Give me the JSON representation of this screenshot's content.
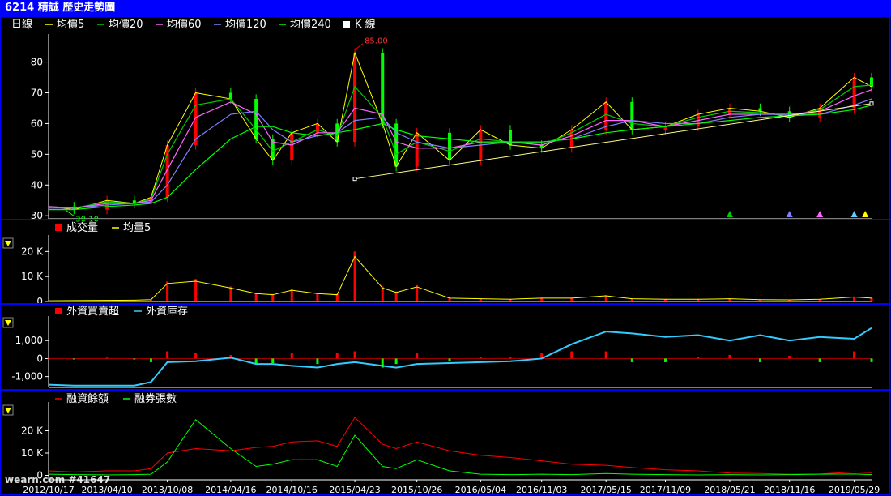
{
  "title": "6214 精誠  歷史走勢圖",
  "watermark": "wearn.com  #41647",
  "colors": {
    "frame": "#0000ff",
    "axis": "#ffffff",
    "candle_up": "#ff0000",
    "candle_down": "#00ff00",
    "ma5": "#ffff00",
    "ma20": "#00cc00",
    "ma60": "#ff66ff",
    "ma120": "#8080ff",
    "ma240": "#00ff00",
    "trendline": "#ffff88",
    "volume": "#ff0000",
    "volume_ma5": "#ffff00",
    "foreign_net": "#ff0000",
    "foreign_net_neg": "#00ff00",
    "foreign_inventory": "#33ccff",
    "margin": "#ff0000",
    "short": "#00ff00"
  },
  "chart_data": [
    {
      "type": "line",
      "panel": "price",
      "legend": [
        "日線",
        "均價5",
        "均價20",
        "均價60",
        "均價120",
        "均價240",
        "K 線"
      ],
      "y_ticks": [
        "30",
        "40",
        "50",
        "60",
        "70",
        "80"
      ],
      "ylim": [
        29,
        87
      ],
      "annotations": {
        "high": "85.00",
        "low": "30.10"
      },
      "x": [
        "2012/10/17",
        "2013/01/01",
        "2013/04/10",
        "2013/07/01",
        "2013/08/20",
        "2013/10/08",
        "2014/01/01",
        "2014/04/16",
        "2014/07/01",
        "2014/08/20",
        "2014/10/16",
        "2015/01/01",
        "2015/03/01",
        "2015/04/23",
        "2015/07/15",
        "2015/08/25",
        "2015/10/26",
        "2016/02/01",
        "2016/05/04",
        "2016/08/01",
        "2016/11/03",
        "2017/02/01",
        "2017/05/15",
        "2017/08/01",
        "2017/11/09",
        "2018/02/15",
        "2018/05/21",
        "2018/08/20",
        "2018/11/16",
        "2019/02/15",
        "2019/05/29",
        "2019/07/20"
      ],
      "series": [
        {
          "name": "K 線",
          "values": [
            33,
            32,
            35,
            34,
            36,
            53,
            70,
            68,
            55,
            48,
            57,
            60,
            54,
            83,
            60,
            46,
            57,
            48,
            58,
            53,
            52,
            58,
            67,
            58,
            59,
            63,
            65,
            64,
            62,
            65,
            75,
            72
          ]
        },
        {
          "name": "均價20",
          "values": [
            33,
            32.5,
            34.5,
            34,
            35.5,
            50,
            66,
            68,
            58,
            51,
            54,
            58,
            56,
            72,
            62,
            50,
            54,
            51,
            55,
            54,
            53,
            57,
            63,
            60,
            59,
            62,
            64,
            63.5,
            62.5,
            64.5,
            72,
            72.5
          ]
        },
        {
          "name": "均價60",
          "values": [
            33,
            32.5,
            34,
            34,
            35,
            45,
            62,
            67,
            63,
            54,
            53,
            57,
            57,
            65,
            63,
            54,
            52,
            52,
            54,
            54,
            53,
            56,
            61,
            61,
            59,
            61,
            63,
            63,
            63,
            64,
            69,
            71
          ]
        },
        {
          "name": "均價120",
          "values": [
            32.5,
            32.5,
            33.5,
            34,
            34.5,
            40,
            55,
            63,
            64,
            58,
            54,
            56,
            57,
            61,
            62,
            57,
            54,
            52,
            53,
            54,
            54,
            55,
            59,
            61,
            60,
            60,
            62,
            63,
            63,
            63,
            66,
            68
          ]
        },
        {
          "name": "均價240",
          "values": [
            32,
            32,
            33,
            33.5,
            34,
            36,
            45,
            55,
            59,
            59,
            57,
            56,
            57,
            58,
            60,
            58,
            56,
            55,
            54,
            54,
            54,
            55,
            57,
            58,
            59,
            60,
            61,
            62,
            62.5,
            63,
            64.5,
            66
          ]
        }
      ],
      "trendline": {
        "from": [
          "2015/04/23",
          42
        ],
        "to": [
          "2019/07/20",
          66.5
        ]
      },
      "markers": [
        {
          "x": "2018/05/21",
          "color": "#00cc00"
        },
        {
          "x": "2018/11/16",
          "color": "#8080ff"
        },
        {
          "x": "2019/02/15",
          "color": "#ff66ff"
        },
        {
          "x": "2019/05/29",
          "color": "#66ccff"
        },
        {
          "x": "2019/07/01",
          "color": "#ffff00"
        }
      ]
    },
    {
      "type": "bar",
      "panel": "volume",
      "legend": [
        "成交量",
        "均量5"
      ],
      "y_ticks": [
        "0",
        "10 K",
        "20 K"
      ],
      "ylim": [
        0,
        24000
      ],
      "x": [
        "2012/10/17",
        "2013/01/01",
        "2013/04/10",
        "2013/07/01",
        "2013/08/20",
        "2013/10/08",
        "2014/01/01",
        "2014/04/16",
        "2014/07/01",
        "2014/08/20",
        "2014/10/16",
        "2015/01/01",
        "2015/03/01",
        "2015/04/23",
        "2015/07/15",
        "2015/08/25",
        "2015/10/26",
        "2016/02/01",
        "2016/05/04",
        "2016/08/01",
        "2016/11/03",
        "2017/02/01",
        "2017/05/15",
        "2017/08/01",
        "2017/11/09",
        "2018/02/15",
        "2018/05/21",
        "2018/08/20",
        "2018/11/16",
        "2019/02/15",
        "2019/05/29",
        "2019/07/20"
      ],
      "values": [
        300,
        400,
        500,
        600,
        800,
        8000,
        9000,
        6000,
        3500,
        3000,
        5000,
        3500,
        3000,
        20000,
        6000,
        4000,
        6500,
        1500,
        1200,
        1000,
        1500,
        1500,
        2500,
        1200,
        1000,
        1000,
        1200,
        800,
        700,
        1000,
        2000,
        1500
      ]
    },
    {
      "type": "bar",
      "panel": "foreign",
      "legend": [
        "外資買賣超",
        "外資庫存"
      ],
      "y_ticks": [
        "-1,000",
        "0",
        "1,000"
      ],
      "ylim": [
        -1600,
        2000
      ],
      "x": [
        "2012/10/17",
        "2013/01/01",
        "2013/04/10",
        "2013/07/01",
        "2013/08/20",
        "2013/10/08",
        "2014/01/01",
        "2014/04/16",
        "2014/07/01",
        "2014/08/20",
        "2014/10/16",
        "2015/01/01",
        "2015/03/01",
        "2015/04/23",
        "2015/07/15",
        "2015/08/25",
        "2015/10/26",
        "2016/02/01",
        "2016/05/04",
        "2016/08/01",
        "2016/11/03",
        "2017/02/01",
        "2017/05/15",
        "2017/08/01",
        "2017/11/09",
        "2018/02/15",
        "2018/05/21",
        "2018/08/20",
        "2018/11/16",
        "2019/02/15",
        "2019/05/29",
        "2019/07/20"
      ],
      "values": [
        0,
        -50,
        50,
        -50,
        -200,
        400,
        300,
        200,
        -300,
        -250,
        300,
        -300,
        300,
        400,
        -500,
        -300,
        300,
        -150,
        100,
        100,
        300,
        400,
        400,
        -200,
        -200,
        100,
        200,
        -200,
        150,
        -200,
        400,
        -200
      ],
      "inventory": [
        -1450,
        -1500,
        -1500,
        -1500,
        -1300,
        -200,
        -150,
        50,
        -300,
        -300,
        -400,
        -500,
        -300,
        -200,
        -400,
        -500,
        -300,
        -250,
        -200,
        -150,
        0,
        800,
        1500,
        1400,
        1200,
        1300,
        1000,
        1300,
        1000,
        1200,
        1100,
        1700
      ]
    },
    {
      "type": "line",
      "panel": "margin",
      "legend": [
        "融資餘額",
        "融券張數"
      ],
      "y_ticks": [
        "0",
        "10 K",
        "20 K"
      ],
      "ylim": [
        -2000,
        30000
      ],
      "x": [
        "2012/10/17",
        "2013/01/01",
        "2013/04/10",
        "2013/07/01",
        "2013/08/20",
        "2013/10/08",
        "2014/01/01",
        "2014/04/16",
        "2014/07/01",
        "2014/08/20",
        "2014/10/16",
        "2015/01/01",
        "2015/03/01",
        "2015/04/23",
        "2015/07/15",
        "2015/08/25",
        "2015/10/26",
        "2016/02/01",
        "2016/05/04",
        "2016/08/01",
        "2016/11/03",
        "2017/02/01",
        "2017/05/15",
        "2017/08/01",
        "2017/11/09",
        "2018/02/15",
        "2018/05/21",
        "2018/08/20",
        "2018/11/16",
        "2019/02/15",
        "2019/05/29",
        "2019/07/20"
      ],
      "series": [
        {
          "name": "融資餘額",
          "values": [
            2000,
            1500,
            2000,
            2000,
            3000,
            10000,
            12000,
            11000,
            12500,
            13000,
            15000,
            15500,
            13000,
            26000,
            14000,
            12000,
            15000,
            11000,
            9000,
            8000,
            6500,
            5000,
            4500,
            3500,
            2500,
            2000,
            1000,
            800,
            500,
            600,
            1500,
            1200
          ]
        },
        {
          "name": "融券張數",
          "values": [
            500,
            300,
            200,
            300,
            500,
            6000,
            25000,
            12000,
            4000,
            5000,
            7000,
            7000,
            4000,
            18000,
            4000,
            3000,
            7000,
            2000,
            500,
            300,
            500,
            300,
            800,
            500,
            300,
            200,
            300,
            200,
            300,
            500,
            600,
            300
          ]
        }
      ],
      "x_tick_labels": [
        "2012/10/17",
        "2013/04/10",
        "2013/10/08",
        "2014/04/16",
        "2014/10/16",
        "2015/04/23",
        "2015/10/26",
        "2016/05/04",
        "2016/11/03",
        "2017/05/15",
        "2017/11/09",
        "2018/05/21",
        "2018/11/16",
        "2019/05/29"
      ]
    }
  ]
}
